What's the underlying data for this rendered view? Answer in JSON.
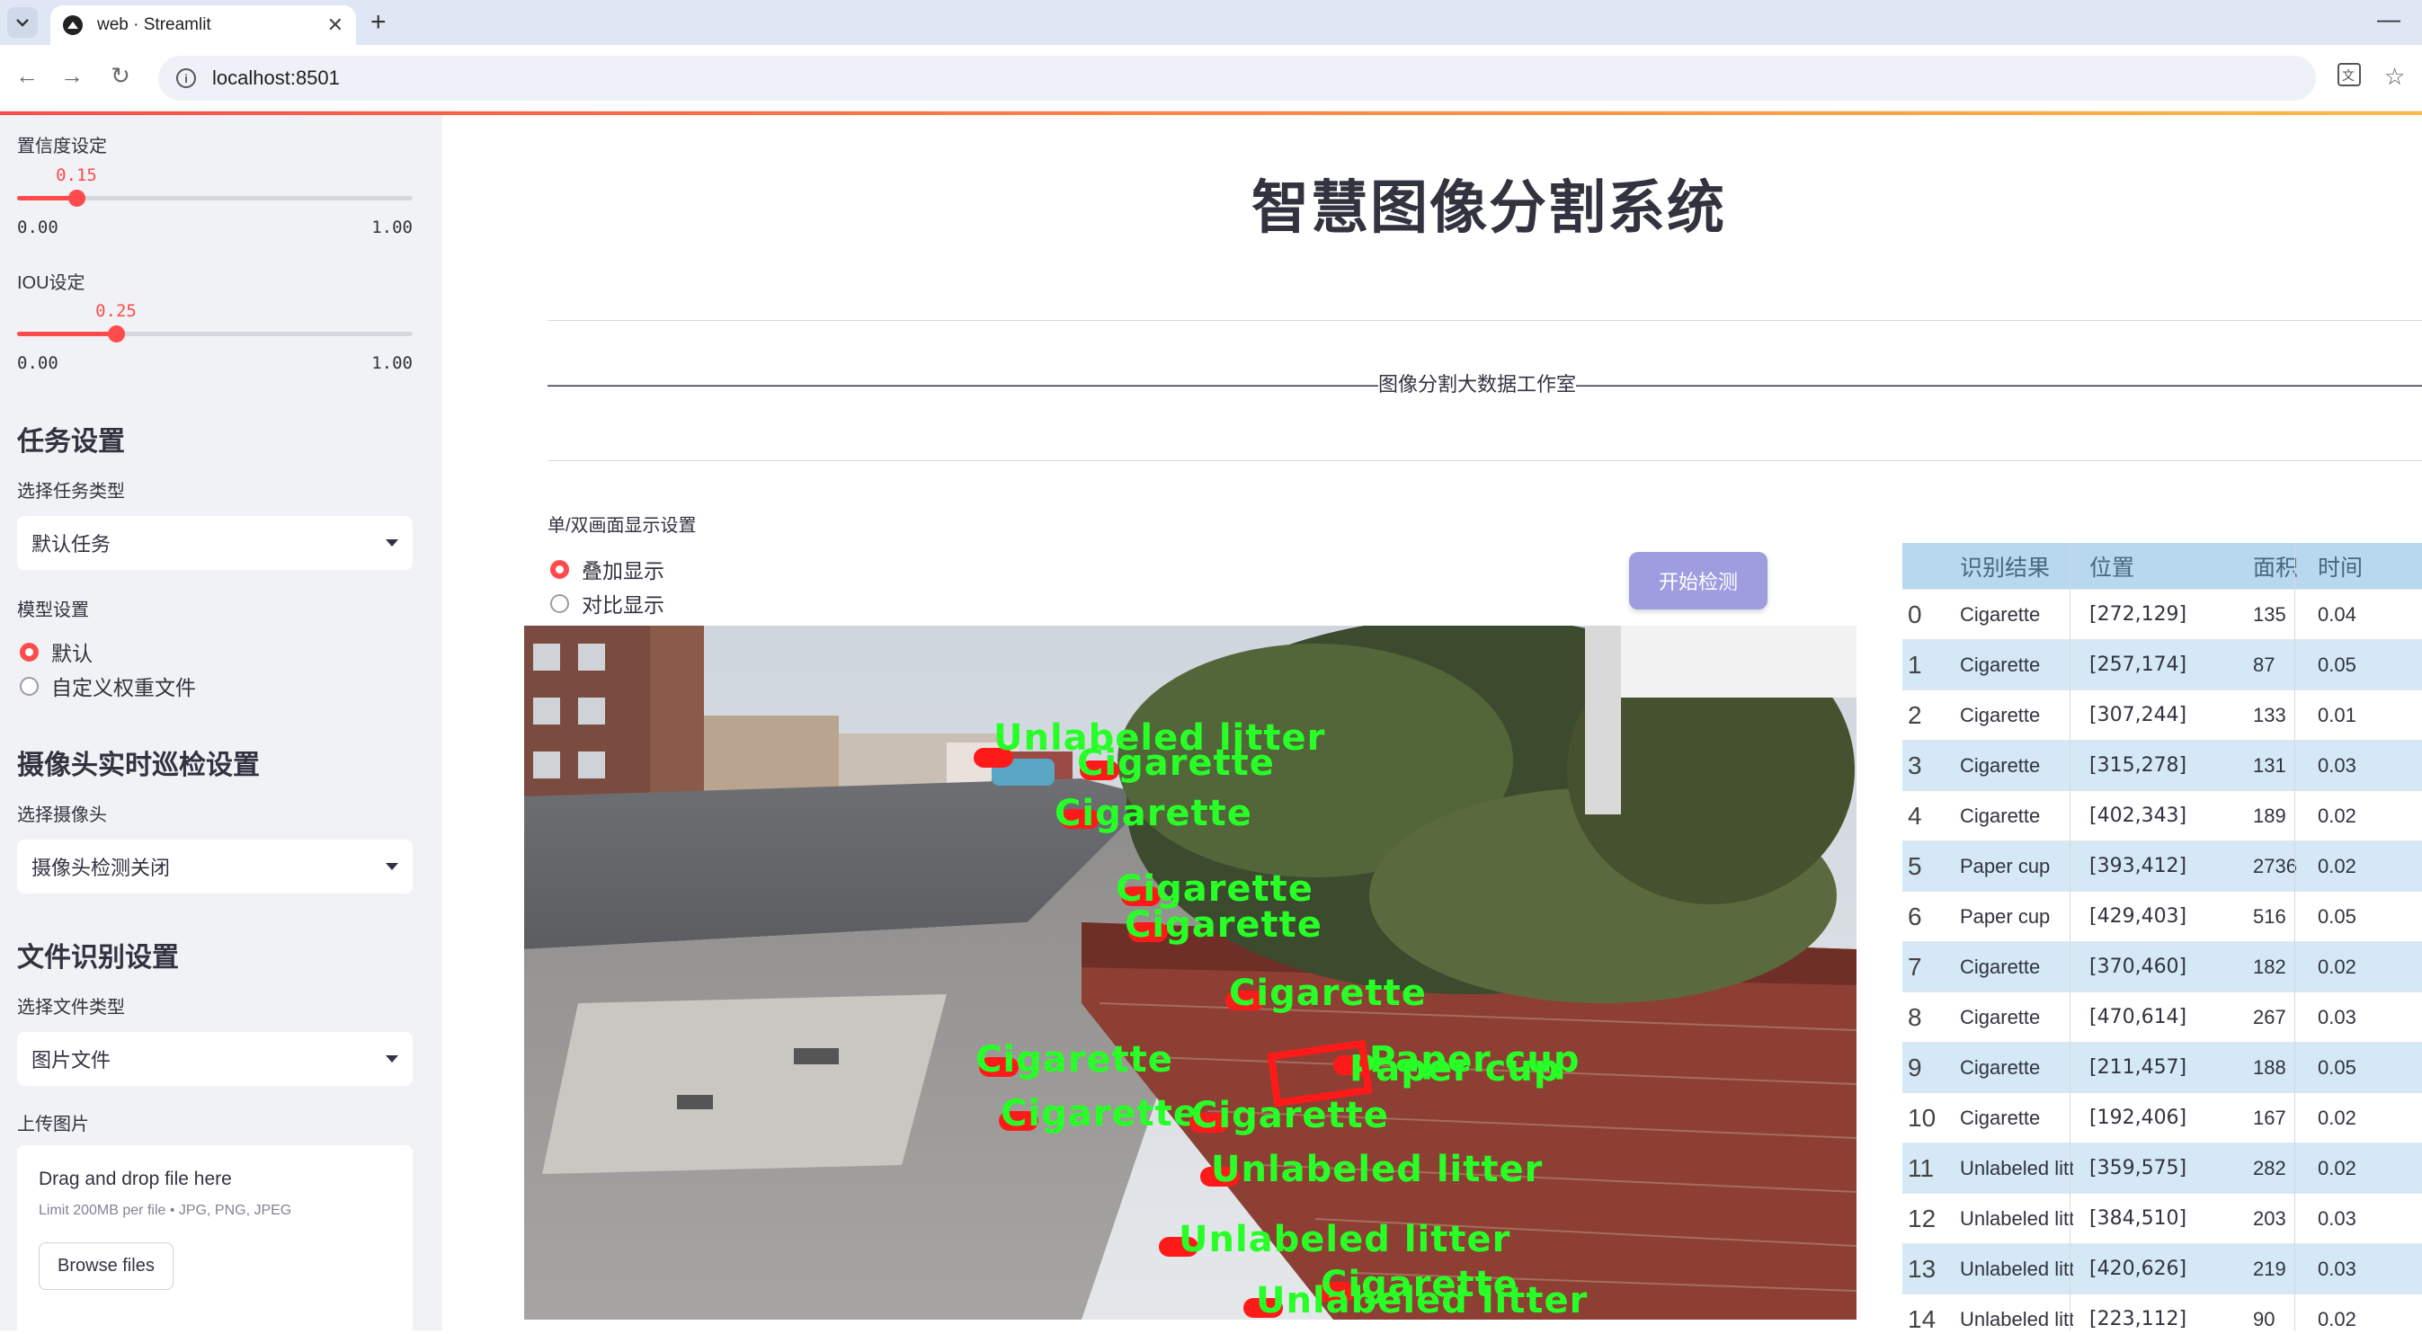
{
  "browser": {
    "tab_title": "web · Streamlit",
    "url": "localhost:8501"
  },
  "sidebar": {
    "conf_label": "置信度设定",
    "conf_value": "0.15",
    "conf_fraction": 0.15,
    "conf_min": "0.00",
    "conf_max": "1.00",
    "iou_label": "IOU设定",
    "iou_value": "0.25",
    "iou_fraction": 0.25,
    "iou_min": "0.00",
    "iou_max": "1.00",
    "task_header": "任务设置",
    "task_type_label": "选择任务类型",
    "task_type_value": "默认任务",
    "model_label": "模型设置",
    "model_opt_default": "默认",
    "model_opt_custom": "自定义权重文件",
    "camera_header": "摄像头实时巡检设置",
    "camera_label": "选择摄像头",
    "camera_value": "摄像头检测关闭",
    "file_header": "文件识别设置",
    "file_type_label": "选择文件类型",
    "file_type_value": "图片文件",
    "upload_label": "上传图片",
    "upload_drag": "Drag and drop file here",
    "upload_limit": "Limit 200MB per file • JPG, PNG, JPEG",
    "upload_button": "Browse files"
  },
  "main": {
    "title": "智慧图像分割系统",
    "studio_line": "——————————————————————————————————————————图像分割大数据工作室——————————————————————————————————————————————",
    "display_mode_label": "单/双画面显示设置",
    "mode_overlay": "叠加显示",
    "mode_compare": "对比显示",
    "start_button": "开始检测"
  },
  "detections_overlay": [
    {
      "text": "Unlabeled litter"
    },
    {
      "text": "Cigarette"
    },
    {
      "text": "Cigarette"
    },
    {
      "text": "Cigarette"
    },
    {
      "text": "Cigarette"
    },
    {
      "text": "Cigarette"
    },
    {
      "text": "Paper cup"
    },
    {
      "text": "Paper cup"
    },
    {
      "text": "Cigarette"
    },
    {
      "text": "Cigarette"
    },
    {
      "text": "Cigarette"
    },
    {
      "text": "Unlabeled litter"
    },
    {
      "text": "Unlabeled litter"
    },
    {
      "text": "Cigarette"
    },
    {
      "text": "Unlabeled litter"
    }
  ],
  "table": {
    "headers": [
      "识别结果",
      "位置",
      "面积",
      "时间"
    ],
    "rows": [
      [
        "0",
        "Cigarette",
        "[272,129]",
        "135",
        "0.04"
      ],
      [
        "1",
        "Cigarette",
        "[257,174]",
        "87",
        "0.05"
      ],
      [
        "2",
        "Cigarette",
        "[307,244]",
        "133",
        "0.01"
      ],
      [
        "3",
        "Cigarette",
        "[315,278]",
        "131",
        "0.03"
      ],
      [
        "4",
        "Cigarette",
        "[402,343]",
        "189",
        "0.02"
      ],
      [
        "5",
        "Paper cup",
        "[393,412]",
        "2736",
        "0.02"
      ],
      [
        "6",
        "Paper cup",
        "[429,403]",
        "516",
        "0.05"
      ],
      [
        "7",
        "Cigarette",
        "[370,460]",
        "182",
        "0.02"
      ],
      [
        "8",
        "Cigarette",
        "[470,614]",
        "267",
        "0.03"
      ],
      [
        "9",
        "Cigarette",
        "[211,457]",
        "188",
        "0.05"
      ],
      [
        "10",
        "Cigarette",
        "[192,406]",
        "167",
        "0.02"
      ],
      [
        "11",
        "Unlabeled litter",
        "[359,575]",
        "282",
        "0.02"
      ],
      [
        "12",
        "Unlabeled litter",
        "[384,510]",
        "203",
        "0.03"
      ],
      [
        "13",
        "Unlabeled litter",
        "[420,626]",
        "219",
        "0.03"
      ],
      [
        "14",
        "Unlabeled litter",
        "[223,112]",
        "90",
        "0.02"
      ]
    ]
  },
  "colors": {
    "accent": "#ff4b4b",
    "button_start": "#9d9de0",
    "label_green": "#27ff27",
    "mask_red": "#ff1a1a",
    "table_stripe": "#d4e8f6"
  }
}
